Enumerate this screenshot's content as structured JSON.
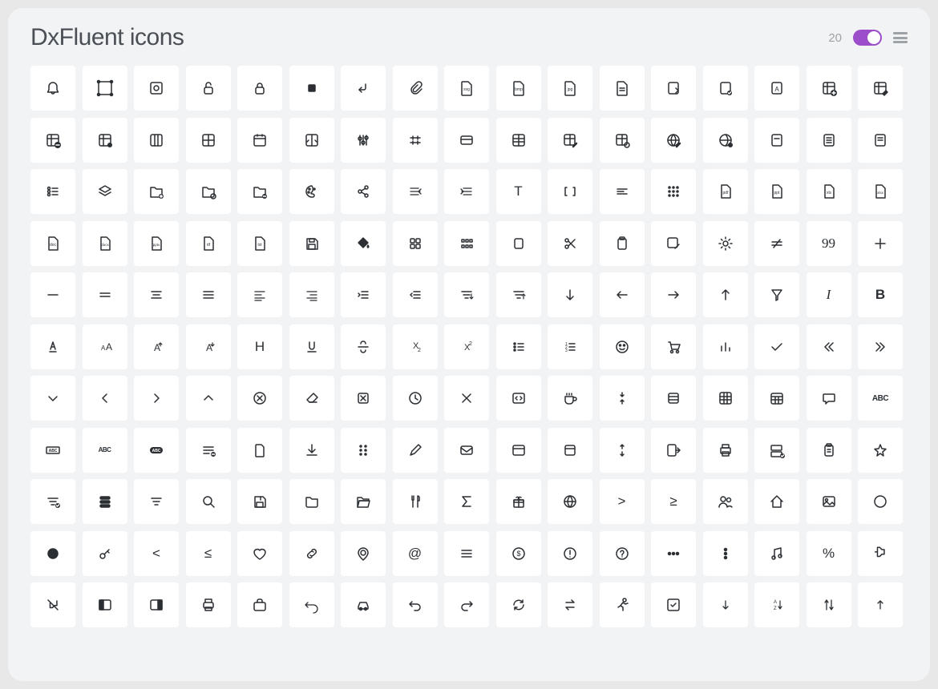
{
  "header": {
    "title": "DxFluent icons",
    "count": "20"
  },
  "icons": [
    "bell",
    "select",
    "bounding-box",
    "unlock",
    "lock",
    "stop",
    "enter",
    "attachment",
    "file-svg",
    "file-bmp",
    "file-jpg",
    "file",
    "file-arrow",
    "file-check",
    "file-a",
    "grid-plus",
    "grid-edit",
    "grid-remove",
    "grid-settings",
    "grid-columns",
    "grid-split",
    "grid-date",
    "grid-expand",
    "sliders",
    "measure",
    "card",
    "table",
    "table-edit",
    "table-config",
    "globe-edit",
    "globe-check",
    "note",
    "note-lines",
    "note-page",
    "checklist",
    "layers",
    "folder-plus",
    "folder-gear",
    "folder-add",
    "palette",
    "share",
    "arrow-right-lines",
    "arrow-left-lines",
    "text-t",
    "brackets",
    "align-left-sm",
    "keypad",
    "file-pdf",
    "file-ppt",
    "file-xls",
    "file-xlsx",
    "file-doc",
    "file-docx",
    "file-pptx",
    "file-rtf",
    "file-txt",
    "save",
    "paint-bucket",
    "grid-2x2",
    "grid-dots",
    "rect",
    "scissors",
    "clipboard",
    "edit-box",
    "gear",
    "not-equal",
    "quote",
    "plus",
    "minus",
    "equals",
    "text-center",
    "hamburger",
    "align-left",
    "align-right",
    "indent",
    "outdent",
    "filter-v",
    "filter-up",
    "arrow-down",
    "arrow-left",
    "arrow-right",
    "arrow-up",
    "filter-funnel",
    "italic",
    "bold",
    "highlight",
    "font-size",
    "font-up",
    "font-down",
    "letter-h",
    "underline",
    "strikethrough",
    "subscript",
    "superscript",
    "bullets",
    "numbered",
    "face",
    "cart",
    "bars",
    "check",
    "chevrons-left",
    "chevrons-right",
    "chevron-down",
    "chevron-left",
    "chevron-right",
    "chevron-up",
    "x-circle",
    "eraser",
    "x-square",
    "clock",
    "x",
    "code-box",
    "coffee",
    "v-compress",
    "stack",
    "grid-3x3",
    "calendar-grid",
    "comment",
    "abc",
    "abc-box",
    "abc-small",
    "abc-pill",
    "list-minus",
    "document",
    "download",
    "dots-grid",
    "pencil",
    "mail",
    "window",
    "app",
    "v-expand",
    "exit",
    "printer",
    "server-check",
    "clipboard-list",
    "star",
    "filter-check",
    "rows",
    "filter",
    "search",
    "save-alt",
    "folder",
    "folder-open",
    "utensils",
    "sigma",
    "gift",
    "globe",
    "greater",
    "greater-eq",
    "users",
    "home",
    "image",
    "circle",
    "dot",
    "key",
    "less",
    "less-eq",
    "heart",
    "link",
    "pin",
    "at",
    "lines",
    "dollar",
    "alert",
    "help",
    "dots-h",
    "dots-v",
    "music",
    "percent",
    "pushpin",
    "unpin",
    "sidebar-left",
    "sidebar-right",
    "print",
    "briefcase",
    "undo",
    "car",
    "undo-alt",
    "redo",
    "refresh",
    "swap",
    "running",
    "check-square",
    "down-sm",
    "sort-az",
    "sort-v",
    "up-sm"
  ]
}
